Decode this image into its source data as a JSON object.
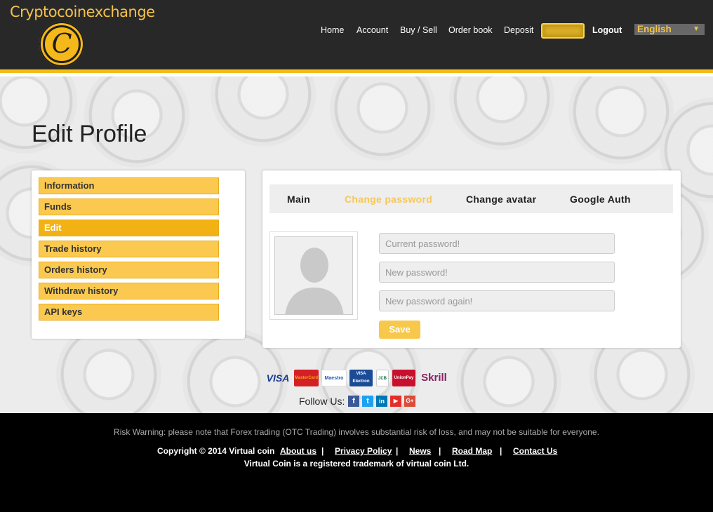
{
  "header": {
    "brand": "Cryptocoinexchange",
    "logo_letter": "C",
    "nav": {
      "home": "Home",
      "account": "Account",
      "buy_sell": "Buy / Sell",
      "order_book": "Order book",
      "deposit": "Deposit",
      "logout": "Logout"
    },
    "language": "English",
    "language_arrow": "▼"
  },
  "page": {
    "title": "Edit Profile"
  },
  "sidebar": {
    "items": [
      {
        "label": "Information"
      },
      {
        "label": "Funds"
      },
      {
        "label": "Edit"
      },
      {
        "label": "Trade history"
      },
      {
        "label": "Orders history"
      },
      {
        "label": "Withdraw history"
      },
      {
        "label": "API keys"
      }
    ]
  },
  "tabs": {
    "main": "Main",
    "change_password": "Change password",
    "change_avatar": "Change avatar",
    "google_auth": "Google Auth"
  },
  "form": {
    "current_placeholder": "Current password!",
    "new_placeholder": "New password!",
    "again_placeholder": "New password again!",
    "save": "Save"
  },
  "payments": {
    "visa": "VISA",
    "mastercard": "MasterCard",
    "maestro": "Maestro",
    "visa_electron": "VISA Electron",
    "jcb": "JCB",
    "unionpay": "UnionPay",
    "skrill": "Skrill"
  },
  "social": {
    "follow_label": "Follow Us:",
    "facebook": "f",
    "twitter": "t",
    "linkedin": "in",
    "youtube": "▶",
    "googleplus": "G+"
  },
  "footer": {
    "risk": "Risk Warning: please note that Forex trading (OTC Trading) involves substantial risk of loss, and may not be suitable for everyone.",
    "copyright": "Copyright © 2014 Virtual coin",
    "sep": "|",
    "about": "About us",
    "privacy": "Privacy Policy",
    "news": "News",
    "roadmap": "Road Map",
    "contact": "Contact Us",
    "trademark": "Virtual Coin is a registered trademark of virtual coin Ltd."
  },
  "colors": {
    "accent": "#f5bb18",
    "header_bg": "#282828",
    "menu_item": "#fbc94f",
    "menu_active": "#f3b214",
    "tab_active": "#f6c75b"
  }
}
